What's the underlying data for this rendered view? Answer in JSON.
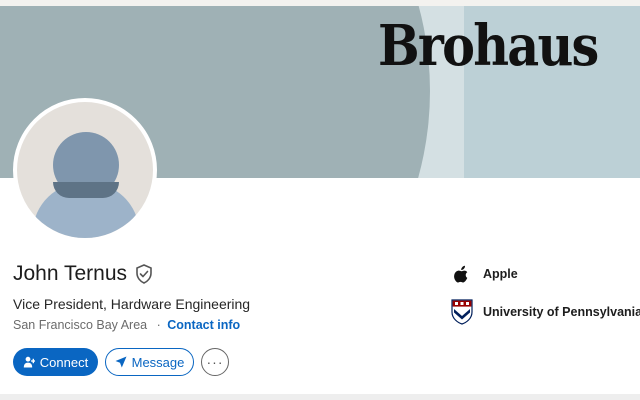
{
  "profile": {
    "banner": {
      "brand_text": "Brohaus"
    },
    "name": "John Ternus",
    "headline": "Vice President, Hardware Engineering",
    "location": "San Francisco Bay Area",
    "separator": "·",
    "contact_info_label": "Contact info",
    "verified_icon": "verified-shield-icon"
  },
  "actions": {
    "connect_label": "Connect",
    "message_label": "Message",
    "more_label": "···"
  },
  "organizations": [
    {
      "name": "Apple",
      "icon": "apple-logo-icon"
    },
    {
      "name": "University of Pennsylvania",
      "icon": "penn-shield-icon"
    }
  ],
  "colors": {
    "accent": "#0a66c2",
    "banner": "#9fb1b5",
    "banner_panel": "#bcd0d6"
  }
}
